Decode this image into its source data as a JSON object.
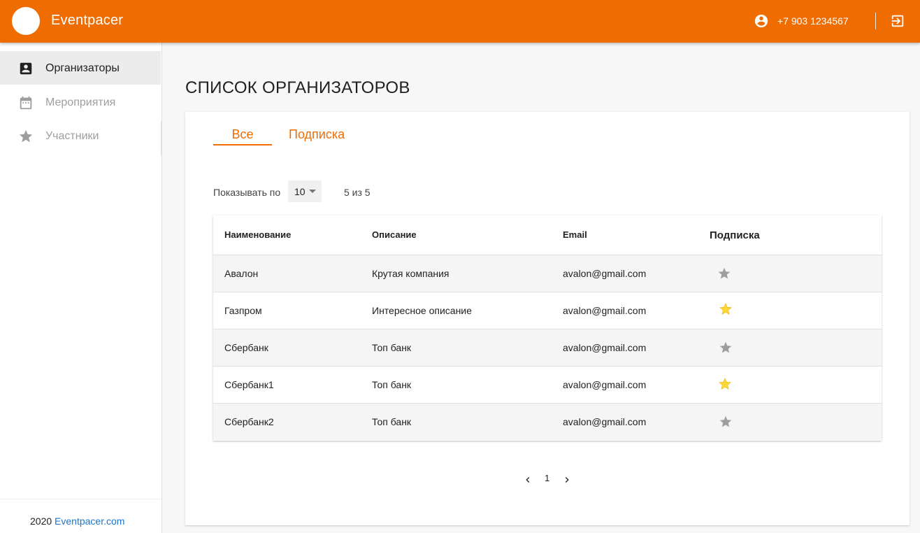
{
  "app": {
    "title": "Eventpacer"
  },
  "header": {
    "phone": "+7 903 1234567"
  },
  "sidebar": {
    "items": [
      {
        "label": "Организаторы",
        "icon": "account-box-icon",
        "active": true
      },
      {
        "label": "Мероприятия",
        "icon": "calendar-icon",
        "active": false
      },
      {
        "label": "Участники",
        "icon": "star-icon",
        "active": false
      }
    ],
    "footer": {
      "year": "2020",
      "link_text": "Eventpacer.com"
    }
  },
  "page": {
    "title": "СПИСОК ОРГАНИЗАТОРОВ"
  },
  "tabs": [
    {
      "label": "Все",
      "active": true
    },
    {
      "label": "Подписка",
      "active": false
    }
  ],
  "pagination_controls": {
    "per_page_label": "Показывать по",
    "per_page_value": "10",
    "count_text": "5 из 5",
    "current_page": "1"
  },
  "table": {
    "columns": [
      "Наименование",
      "Описание",
      "Email",
      "Подписка"
    ],
    "rows": [
      {
        "name": "Авалон",
        "description": "Крутая компания",
        "email": "avalon@gmail.com",
        "subscribed": false
      },
      {
        "name": "Газпром",
        "description": "Интересное описание",
        "email": "avalon@gmail.com",
        "subscribed": true
      },
      {
        "name": "Сбербанк",
        "description": "Топ банк",
        "email": "avalon@gmail.com",
        "subscribed": false
      },
      {
        "name": "Сбербанк1",
        "description": "Топ банк",
        "email": "avalon@gmail.com",
        "subscribed": true
      },
      {
        "name": "Сбербанк2",
        "description": "Топ банк",
        "email": "avalon@gmail.com",
        "subscribed": false
      }
    ]
  },
  "colors": {
    "accent": "#ef6c00",
    "star_on": "#fdd835",
    "star_off": "#9e9e9e",
    "link": "#1976d2"
  }
}
